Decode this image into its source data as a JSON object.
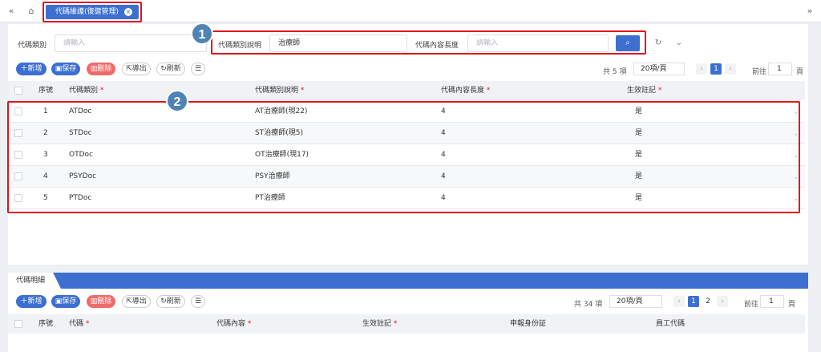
{
  "topbar": {
    "left_nav_icon": "chevrons-left-icon",
    "home_icon": "home-icon",
    "right_nav_icon": "chevrons-right-icon",
    "active_tab_label": "代碼維護(復健管理)",
    "active_tab_close_icon": "close-circle-icon"
  },
  "annotations": {
    "badge1": "1",
    "badge2": "2"
  },
  "filter": {
    "category_label": "代碼類別",
    "category_placeholder": "請輸入",
    "category_desc_label": "代碼類別說明",
    "category_desc_value": "治療師",
    "content_length_label": "代碼內容長度",
    "content_length_placeholder": "請輸入",
    "search_icon": "search-icon",
    "refresh_icon": "refresh-icon",
    "expand_icon": "chevron-down-icon"
  },
  "toolbar": {
    "add_label": "新增",
    "save_label": "保存",
    "delete_label": "刪除",
    "export_label": "導出",
    "refresh_label": "刷新",
    "columns_icon": "column-settings-icon",
    "total_text": "共 5 項",
    "page_size": "20項/頁",
    "current_page": "1",
    "goto_label": "前往",
    "goto_value": "1",
    "page_unit": "頁"
  },
  "master_table": {
    "headers": [
      "序號",
      "代碼類別",
      "代碼類別說明",
      "代碼內容長度",
      "生效註記"
    ],
    "required_mark": "*",
    "rows": [
      {
        "no": "1",
        "code": "ATDoc",
        "desc": "AT治療師(現22)",
        "length": "4",
        "active": "是"
      },
      {
        "no": "2",
        "code": "STDoc",
        "desc": "ST治療師(現5)",
        "length": "4",
        "active": "是"
      },
      {
        "no": "3",
        "code": "OTDoc",
        "desc": "OT治療師(現17)",
        "length": "4",
        "active": "是"
      },
      {
        "no": "4",
        "code": "PSYDoc",
        "desc": "PSY治療師",
        "length": "4",
        "active": "是"
      },
      {
        "no": "5",
        "code": "PTDoc",
        "desc": "PT治療師",
        "length": "4",
        "active": "是"
      }
    ]
  },
  "detail": {
    "tab_label": "代碼明細",
    "toolbar": {
      "add_label": "新增",
      "save_label": "保存",
      "delete_label": "刪除",
      "export_label": "導出",
      "refresh_label": "刷新",
      "total_text": "共 34 項",
      "page_size": "20項/頁",
      "page1": "1",
      "page2": "2",
      "goto_label": "前往",
      "goto_value": "1",
      "page_unit": "頁"
    },
    "headers": [
      "序號",
      "代碼",
      "代碼內容",
      "生效註記",
      "申報身份証",
      "員工代碼"
    ]
  },
  "colors": {
    "accent": "#3d6fd1",
    "danger": "#f06a6a",
    "highlight": "#e0141e",
    "badge": "#4f83b5"
  }
}
